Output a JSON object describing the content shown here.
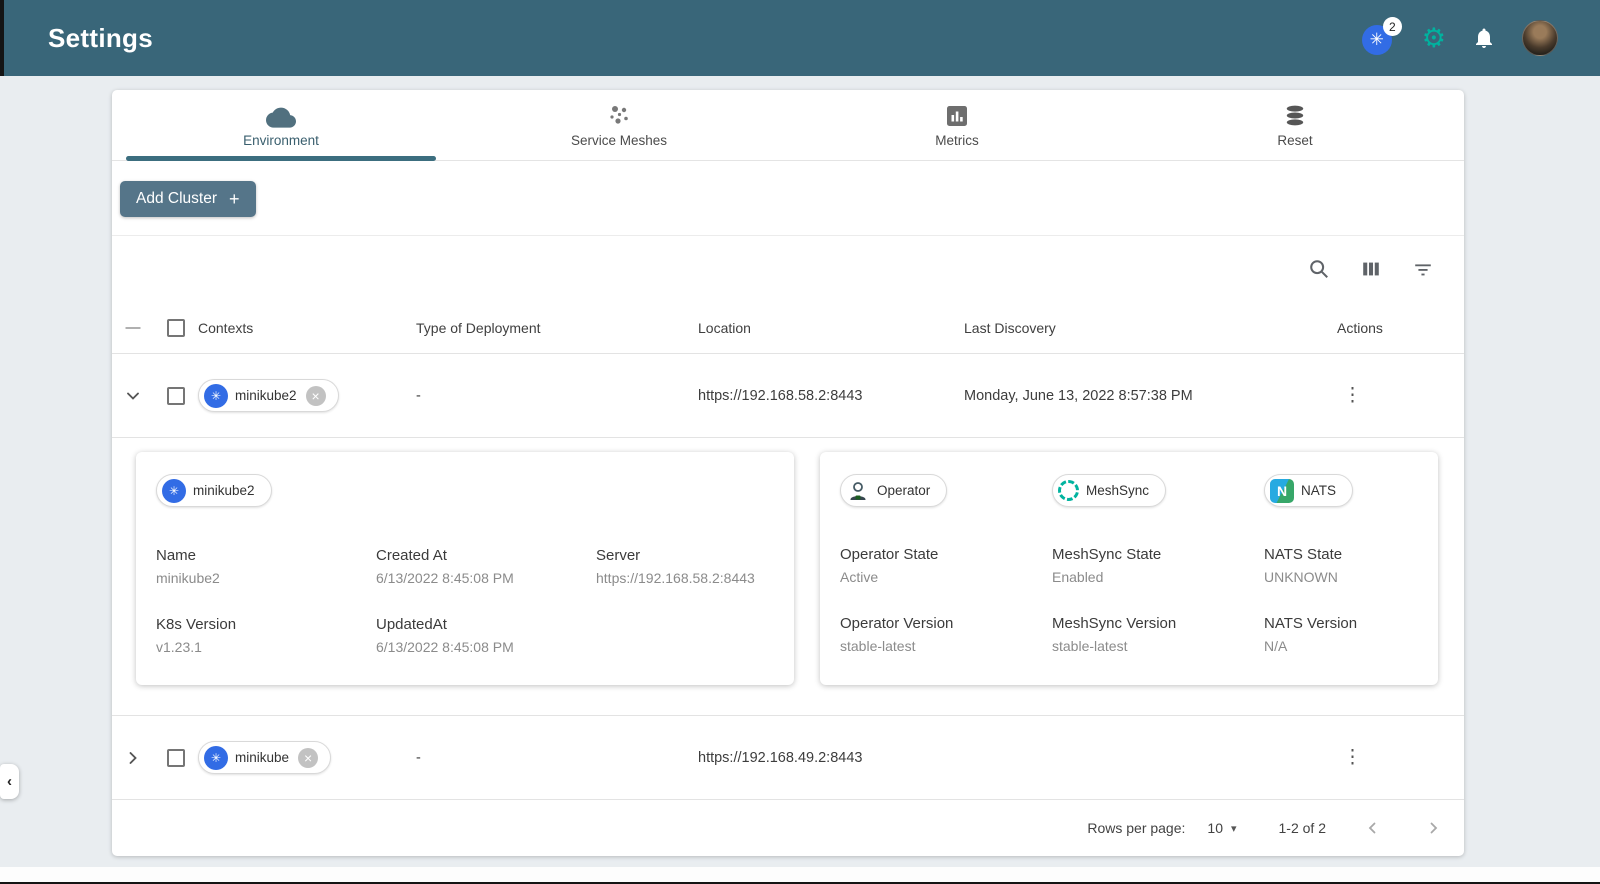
{
  "header": {
    "title": "Settings",
    "kubernetes_badge": "2"
  },
  "icons": {
    "k8s_wheel": "✳",
    "gear": "⚙",
    "close": "×",
    "minus": "—",
    "kebab": "⋮",
    "caret_down": "▾",
    "collapse_left": "‹",
    "nats_letter": "N"
  },
  "colors": {
    "appbar_teal": "#396679",
    "accent_green": "#00B39F",
    "kubernetes_blue": "#326CE5",
    "button_slate": "#557589",
    "tab_underline": "#3C6E7F"
  },
  "tabs": [
    {
      "label": "Environment",
      "active": true
    },
    {
      "label": "Service Meshes",
      "active": false
    },
    {
      "label": "Metrics",
      "active": false
    },
    {
      "label": "Reset",
      "active": false
    }
  ],
  "actions_bar": {
    "add_cluster_label": "Add Cluster",
    "add_cluster_plus": "+"
  },
  "table": {
    "headers": {
      "contexts": "Contexts",
      "type": "Type of Deployment",
      "location": "Location",
      "last_discovery": "Last Discovery",
      "actions": "Actions"
    },
    "rows": [
      {
        "context": "minikube2",
        "type": "-",
        "location": "https://192.168.58.2:8443",
        "last_discovery": "Monday, June 13, 2022 8:57:38 PM"
      },
      {
        "context": "minikube",
        "type": "-",
        "location": "https://192.168.49.2:8443",
        "last_discovery": ""
      }
    ]
  },
  "detail": {
    "chip": "minikube2",
    "name_label": "Name",
    "name_value": "minikube2",
    "created_label": "Created At",
    "created_value": "6/13/2022 8:45:08 PM",
    "server_label": "Server",
    "server_value": "https://192.168.58.2:8443",
    "k8s_label": "K8s Version",
    "k8s_value": "v1.23.1",
    "updated_label": "UpdatedAt",
    "updated_value": "6/13/2022 8:45:08 PM"
  },
  "operator_panel": {
    "operator_chip": "Operator",
    "meshsync_chip": "MeshSync",
    "nats_chip": "NATS",
    "operator_state_label": "Operator State",
    "operator_state_value": "Active",
    "meshsync_state_label": "MeshSync State",
    "meshsync_state_value": "Enabled",
    "nats_state_label": "NATS State",
    "nats_state_value": "UNKNOWN",
    "operator_version_label": "Operator Version",
    "operator_version_value": "stable-latest",
    "meshsync_version_label": "MeshSync Version",
    "meshsync_version_value": "stable-latest",
    "nats_version_label": "NATS Version",
    "nats_version_value": "N/A"
  },
  "pagination": {
    "rows_per_page_label": "Rows per page:",
    "rows_per_page_value": "10",
    "range_text": "1-2 of 2"
  }
}
